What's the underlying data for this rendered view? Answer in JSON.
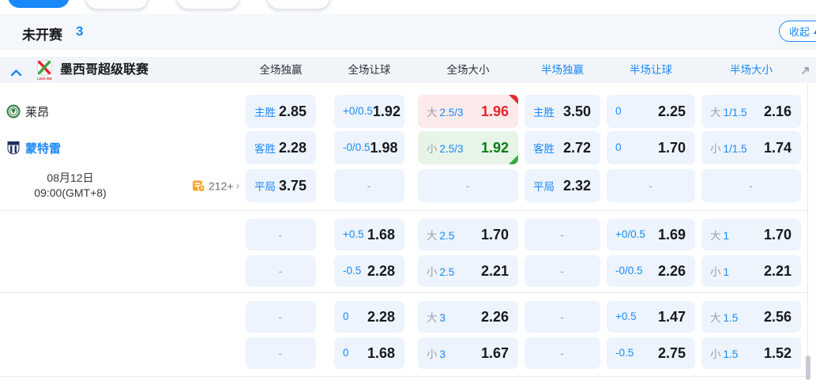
{
  "page": {
    "section_title": "未开赛",
    "section_count": "3",
    "collapse_label": "收起"
  },
  "league": {
    "name": "墨西哥超级联赛",
    "columns": [
      {
        "label": "全场独赢",
        "accent": false
      },
      {
        "label": "全场让球",
        "accent": false
      },
      {
        "label": "全场大小",
        "accent": false
      },
      {
        "label": "半场独赢",
        "accent": true
      },
      {
        "label": "半场让球",
        "accent": true
      },
      {
        "label": "半场大小",
        "accent": true
      }
    ]
  },
  "match": {
    "home_name": "莱昂",
    "away_name": "蒙特雷",
    "date": "08月12日",
    "time": "09:00(GMT+8)",
    "markets_count": "212+"
  },
  "odds_rows": [
    {
      "type": "home",
      "cells": [
        {
          "label": "主胜",
          "value": "2.85"
        },
        {
          "label": "+0/0.5",
          "value": "1.92"
        },
        {
          "prefix": "大",
          "label": "2.5/3",
          "value": "1.96",
          "state": "up"
        },
        {
          "label": "主胜",
          "value": "3.50"
        },
        {
          "label": "0",
          "value": "2.25"
        },
        {
          "prefix": "大",
          "label": "1/1.5",
          "value": "2.16"
        }
      ]
    },
    {
      "type": "away",
      "cells": [
        {
          "label": "客胜",
          "value": "2.28"
        },
        {
          "label": "-0/0.5",
          "value": "1.98"
        },
        {
          "prefix": "小",
          "label": "2.5/3",
          "value": "1.92",
          "state": "down"
        },
        {
          "label": "客胜",
          "value": "2.72"
        },
        {
          "label": "0",
          "value": "1.70"
        },
        {
          "prefix": "小",
          "label": "1/1.5",
          "value": "1.74"
        }
      ]
    },
    {
      "type": "meta",
      "cells": [
        {
          "label": "平局",
          "value": "3.75"
        },
        {
          "dash": "-"
        },
        {
          "dash": "-"
        },
        {
          "label": "平局",
          "value": "2.32"
        },
        {
          "dash": "-"
        },
        {
          "dash": "-"
        }
      ]
    },
    {
      "type": "plain",
      "cells": [
        {
          "dash": "-"
        },
        {
          "label": "+0.5",
          "value": "1.68"
        },
        {
          "prefix": "大",
          "label": "2.5",
          "value": "1.70"
        },
        {
          "dash": "-"
        },
        {
          "label": "+0/0.5",
          "value": "1.69"
        },
        {
          "prefix": "大",
          "label": "1",
          "value": "1.70"
        }
      ]
    },
    {
      "type": "plain",
      "cells": [
        {
          "dash": "-"
        },
        {
          "label": "-0.5",
          "value": "2.28"
        },
        {
          "prefix": "小",
          "label": "2.5",
          "value": "2.21"
        },
        {
          "dash": "-"
        },
        {
          "label": "-0/0.5",
          "value": "2.26"
        },
        {
          "prefix": "小",
          "label": "1",
          "value": "2.21"
        }
      ]
    },
    {
      "type": "plain",
      "cells": [
        {
          "dash": "-"
        },
        {
          "label": "0",
          "value": "2.28"
        },
        {
          "prefix": "大",
          "label": "3",
          "value": "2.26"
        },
        {
          "dash": "-"
        },
        {
          "label": "+0.5",
          "value": "1.47"
        },
        {
          "prefix": "大",
          "label": "1.5",
          "value": "2.56"
        }
      ]
    },
    {
      "type": "plain",
      "cells": [
        {
          "dash": "-"
        },
        {
          "label": "0",
          "value": "1.68"
        },
        {
          "prefix": "小",
          "label": "3",
          "value": "1.67"
        },
        {
          "dash": "-"
        },
        {
          "label": "-0.5",
          "value": "2.75"
        },
        {
          "prefix": "小",
          "label": "1.5",
          "value": "1.52"
        }
      ]
    }
  ],
  "colors": {
    "accent": "#1989fa",
    "rise_red": "#e8232d",
    "fall_green": "#0b7d15",
    "cell_bg": "#edf4fd"
  }
}
